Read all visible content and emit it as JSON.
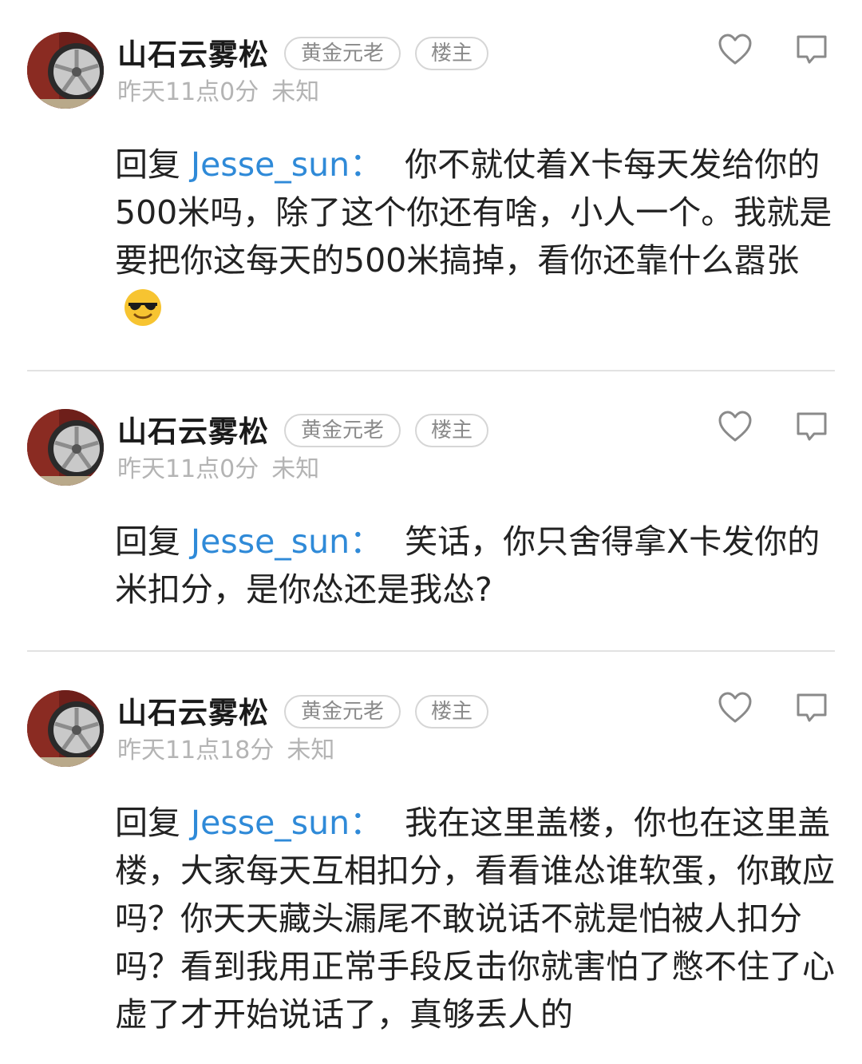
{
  "colors": {
    "mention": "#2f8ad8",
    "meta": "#b4b4b4",
    "divider": "#e2e2e2"
  },
  "posts": [
    {
      "username": "山石云雾松",
      "title_badge": "黄金元老",
      "op_badge": "楼主",
      "time": "昨天11点0分",
      "location": "未知",
      "reply_prefix": "回复 ",
      "mention": "Jesse_sun",
      "colon": "：",
      "body": "你不就仗着X卡每天发给你的500米吗，除了这个你还有啥，小人一个。我就是要把你这每天的500米搞掉，看你还靠什么嚣张",
      "emoji": "sunglasses-emoji"
    },
    {
      "username": "山石云雾松",
      "title_badge": "黄金元老",
      "op_badge": "楼主",
      "time": "昨天11点0分",
      "location": "未知",
      "reply_prefix": "回复 ",
      "mention": "Jesse_sun",
      "colon": "：",
      "body": "笑话，你只舍得拿X卡发你的米扣分，是你怂还是我怂?"
    },
    {
      "username": "山石云雾松",
      "title_badge": "黄金元老",
      "op_badge": "楼主",
      "time": "昨天11点18分",
      "location": "未知",
      "reply_prefix": "回复 ",
      "mention": "Jesse_sun",
      "colon": "：",
      "body": "我在这里盖楼，你也在这里盖楼，大家每天互相扣分，看看谁怂谁软蛋，你敢应吗？你天天藏头漏尾不敢说话不就是怕被人扣分吗？看到我用正常手段反击你就害怕了憋不住了心虚了才开始说话了，真够丢人的"
    }
  ]
}
